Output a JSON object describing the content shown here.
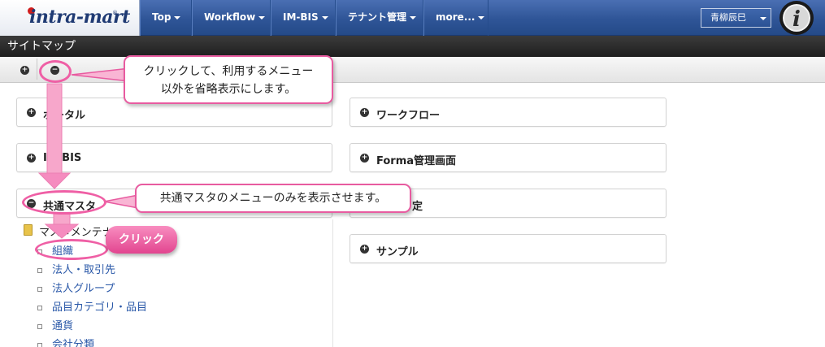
{
  "header": {
    "logo": "intra-mart",
    "nav": [
      {
        "label": "Top"
      },
      {
        "label": "Workflow"
      },
      {
        "label": "IM-BIS"
      },
      {
        "label": "テナント管理"
      },
      {
        "label": "more..."
      }
    ],
    "user": "青柳辰巳"
  },
  "sitemap": {
    "title": "サイトマップ",
    "expand_all": "+",
    "collapse_all": "−"
  },
  "panels": {
    "portal": "ポータル",
    "imbis": "IM-BIS",
    "common_master": "共通マスタ",
    "workflow": "ワークフロー",
    "forma": "Forma管理画面",
    "settings_suffix": "定",
    "sample": "サンプル"
  },
  "common_master_tree": {
    "folder": "マスタメンテナンス",
    "items": [
      "組織",
      "法人・取引先",
      "法人グループ",
      "品目カテゴリ・品目",
      "通貨",
      "会社分類"
    ]
  },
  "annotations": {
    "callout_top_line1": "クリックして、利用するメニュー",
    "callout_top_line2": "以外を省略表示にします。",
    "callout_middle": "共通マスタのメニューのみを表示させます。",
    "click_badge": "クリック"
  },
  "colors": {
    "nav_blue": "#2f5597",
    "annotation_pink": "#e85ba0",
    "link_blue": "#2a58a8"
  }
}
